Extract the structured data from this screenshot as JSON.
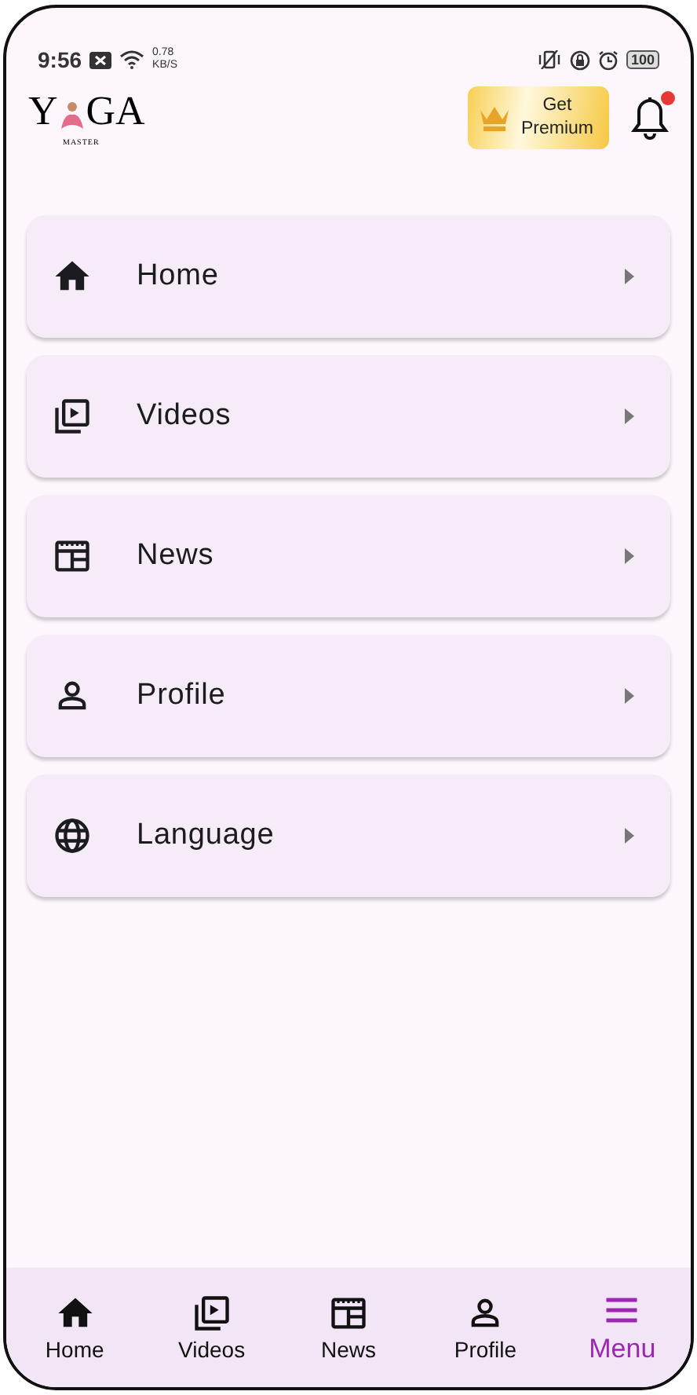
{
  "status_bar": {
    "time": "9:56",
    "speed_value": "0.78",
    "speed_unit": "KB/S",
    "battery": "100"
  },
  "header": {
    "logo": {
      "before": "Y",
      "after": "GA",
      "subtitle": "MASTER"
    },
    "premium": {
      "line_1": "Get",
      "line_2": "Premium"
    },
    "notifications": {
      "unread": true
    }
  },
  "menu": [
    {
      "label": "Home",
      "kind": "home"
    },
    {
      "label": "Videos",
      "kind": "videos"
    },
    {
      "label": "News",
      "kind": "news"
    },
    {
      "label": "Profile",
      "kind": "profile"
    },
    {
      "label": "Language",
      "kind": "language"
    }
  ],
  "bottom_nav": [
    {
      "label": "Home",
      "kind": "home",
      "selected": false
    },
    {
      "label": "Videos",
      "kind": "videos",
      "selected": false
    },
    {
      "label": "News",
      "kind": "news",
      "selected": false
    },
    {
      "label": "Profile",
      "kind": "profile",
      "selected": false
    },
    {
      "label": "Menu",
      "kind": "menu",
      "selected": true
    }
  ]
}
